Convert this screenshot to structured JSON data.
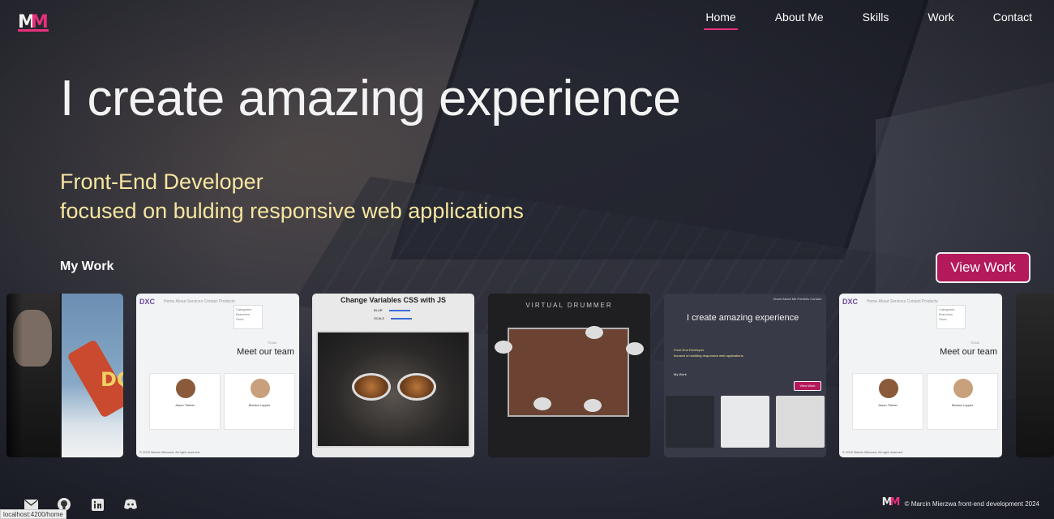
{
  "header": {
    "logo_letters": [
      "M",
      "M"
    ],
    "nav": [
      {
        "label": "Home",
        "active": true
      },
      {
        "label": "About Me",
        "active": false
      },
      {
        "label": "Skills",
        "active": false
      },
      {
        "label": "Work",
        "active": false
      },
      {
        "label": "Contact",
        "active": false
      }
    ]
  },
  "hero": {
    "title": "I create amazing experience",
    "subtitle_line1": "Front-End Developer",
    "subtitle_line2": "focused on bulding responsive web applications"
  },
  "work": {
    "heading": "My Work",
    "view_button": "View Work",
    "cards": {
      "c1": {
        "brand": "DXC",
        "nav": "Home   About   Services   Contact   Products",
        "menu": [
          "Categories",
          "Branches",
          "Store"
        ],
        "team_small": "TEAM",
        "team": "Meet our team",
        "person1": "Jason Timber",
        "person2": "Monica Lopper",
        "footer": "© 2022 Marcin Mierzwa. All right reserved"
      },
      "c2": {
        "title": "Change Variables CSS with JS",
        "slider1": "BLUR",
        "slider2": "SCALE"
      },
      "c3": {
        "title": "VIRTUAL DRUMMER"
      },
      "c4": {
        "nav": "Home   About Me   Portfolio   Contact",
        "title": "I create amazing experience",
        "sub1": "Front-End Developer",
        "sub2": "focused on building responsive web applications",
        "mywork": "My Work",
        "button": "View Work"
      },
      "c5": {
        "brand": "DXC",
        "nav": "Home   About   Services   Contact   Products",
        "menu": [
          "Categories",
          "Branches",
          "Store"
        ],
        "team_small": "TEAM",
        "team": "Meet our team",
        "person1": "Jason Timber",
        "person2": "Monica Lopper",
        "footer": "© 2022 Marcin Mierzwa. All right reserved"
      }
    }
  },
  "footer": {
    "social": [
      "mail-icon",
      "github-icon",
      "linkedin-icon",
      "discord-icon"
    ],
    "copyright": "© Marcin Mierzwa front-end development 2024"
  },
  "status_bar": {
    "url": "localhost:4200/home"
  },
  "colors": {
    "accent": "#e8307c",
    "button": "#b3195b",
    "subtitle": "#f7e6a0"
  }
}
